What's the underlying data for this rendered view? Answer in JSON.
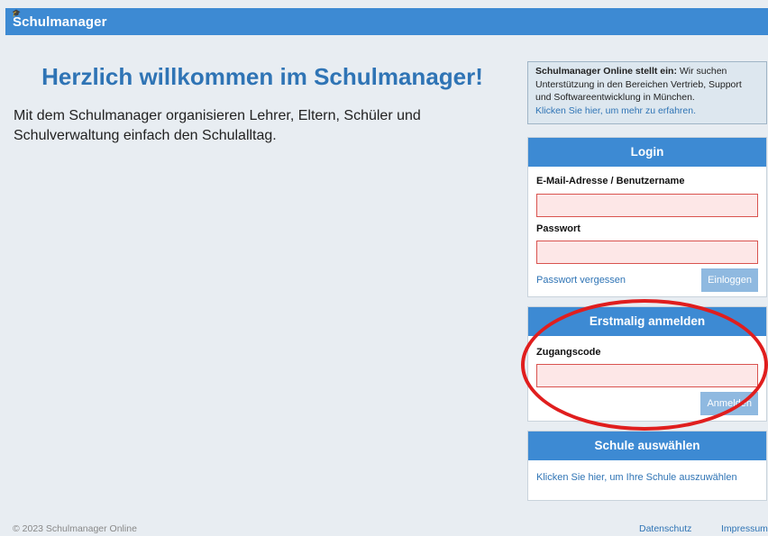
{
  "header": {
    "brand": "Schulmanager",
    "brand_icon": "graduation-cap-icon"
  },
  "welcome": {
    "title": "Herzlich willkommen im Schulmanager!",
    "text": "Mit dem Schulmanager organisieren Lehrer, Eltern, Schüler und Schulverwaltung einfach den Schulalltag."
  },
  "notice": {
    "bold": "Schulmanager Online stellt ein:",
    "text": " Wir suchen Unterstützung in den Bereichen Vertrieb, Support und Softwareentwicklung in München.",
    "link": "Klicken Sie hier, um mehr zu erfahren."
  },
  "login": {
    "title": "Login",
    "user_label": "E-Mail-Adresse / Benutzername",
    "user_value": "",
    "password_label": "Passwort",
    "password_value": "",
    "forgot_link": "Passwort vergessen",
    "submit": "Einloggen"
  },
  "first_login": {
    "title": "Erstmalig anmelden",
    "code_label": "Zugangscode",
    "code_value": "",
    "submit": "Anmelden"
  },
  "school": {
    "title": "Schule auswählen",
    "link": "Klicken Sie hier, um Ihre Schule auszuwählen"
  },
  "footer": {
    "copyright": "© 2023 Schulmanager Online",
    "privacy": "Datenschutz",
    "imprint": "Impressum"
  },
  "colors": {
    "primary": "#3d8ad3",
    "link": "#2f74b5",
    "field_error": "#d9534f",
    "highlight": "#e01e1e"
  }
}
